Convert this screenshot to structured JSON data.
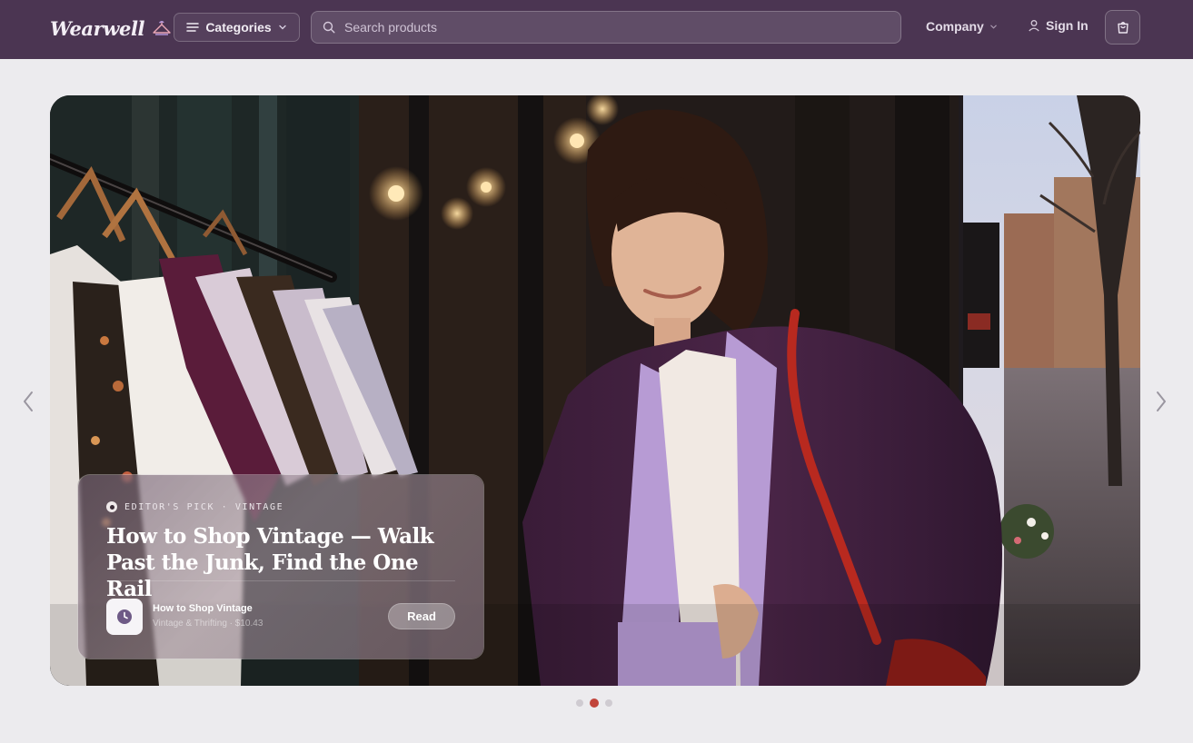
{
  "brand": {
    "name": "Wearwell"
  },
  "header": {
    "categories_label": "Categories",
    "search_placeholder": "Search products",
    "company_label": "Company",
    "signin_label": "Sign In"
  },
  "icons": {
    "logo": "hanger-icon",
    "categories": "menu-icon",
    "categories_chevron": "chevron-down-icon",
    "search": "search-icon",
    "company_chevron": "chevron-down-icon",
    "signin": "user-icon",
    "cart": "shopping-bag-icon",
    "prev": "chevron-left-icon",
    "next": "chevron-right-icon",
    "article": "clock-icon"
  },
  "hero": {
    "eyebrow": "EDITOR'S PICK · VINTAGE",
    "title": "How to Shop Vintage — Walk Past the Junk, Find the One Rail",
    "mini_title": "How to Shop Vintage",
    "mini_subtitle": "Vintage & Thrifting · $10.43",
    "read_label": "Read"
  },
  "carousel": {
    "slide_count": 3,
    "active_index": 1
  },
  "colors": {
    "header_bg": "#4b3552",
    "page_bg": "#ecebee",
    "accent_dot": "#c1443b",
    "coat": "#3c1d3a",
    "lavender": "#b79bd4"
  }
}
